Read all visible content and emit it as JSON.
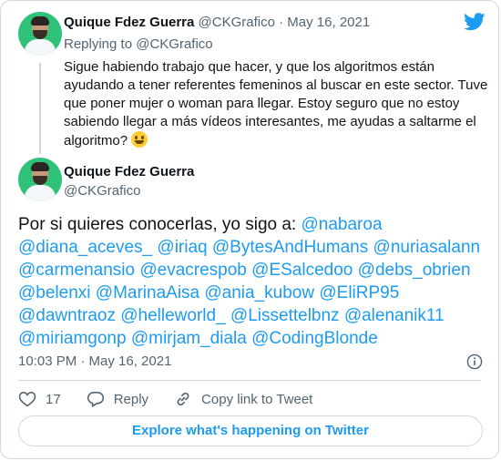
{
  "parent_tweet": {
    "name": "Quique Fdez Guerra",
    "handle": "@CKGrafico",
    "separator": " · ",
    "date": "May 16, 2021",
    "replying_to": "Replying to @CKGrafico",
    "text": "Sigue habiendo trabajo que hacer, y que los algoritmos están ayudando a tener referentes femeninos al buscar en este sector. Tuve que poner mujer o woman para llegar. Estoy seguro que no estoy sabiendo llegar a más vídeos interesantes, me ayudas a saltarme el algoritmo?"
  },
  "main_tweet": {
    "name": "Quique Fdez Guerra",
    "handle": "@CKGrafico",
    "intro": "Por si quieres conocerlas, yo sigo a: ",
    "mentions": [
      "@nabaroa",
      "@diana_aceves_",
      "@iriaq",
      "@BytesAndHumans",
      "@nuriasalann",
      "@carmenansio",
      "@evacrespob",
      "@ESalcedoo",
      "@debs_obrien",
      "@belenxi",
      "@MarinaAisa",
      "@ania_kubow",
      "@EliRP95",
      "@dawntraoz",
      "@helleworld_",
      "@Lissettelbnz",
      "@alenanik11",
      "@miriamgonp",
      "@mirjam_diala",
      "@CodingBlonde"
    ],
    "timestamp": "10:03 PM · May 16, 2021"
  },
  "actions": {
    "likes": "17",
    "reply_label": "Reply",
    "copy_link_label": "Copy link to Tweet"
  },
  "explore_label": "Explore what's happening on Twitter",
  "colors": {
    "accent": "#1d9bf0",
    "muted": "#536471",
    "border": "#cfd9de",
    "avatar_bg": "#2fc37a"
  },
  "icons": [
    "twitter-bird-icon",
    "info-icon",
    "heart-icon",
    "reply-icon",
    "link-icon",
    "grinning-emoji-icon"
  ]
}
